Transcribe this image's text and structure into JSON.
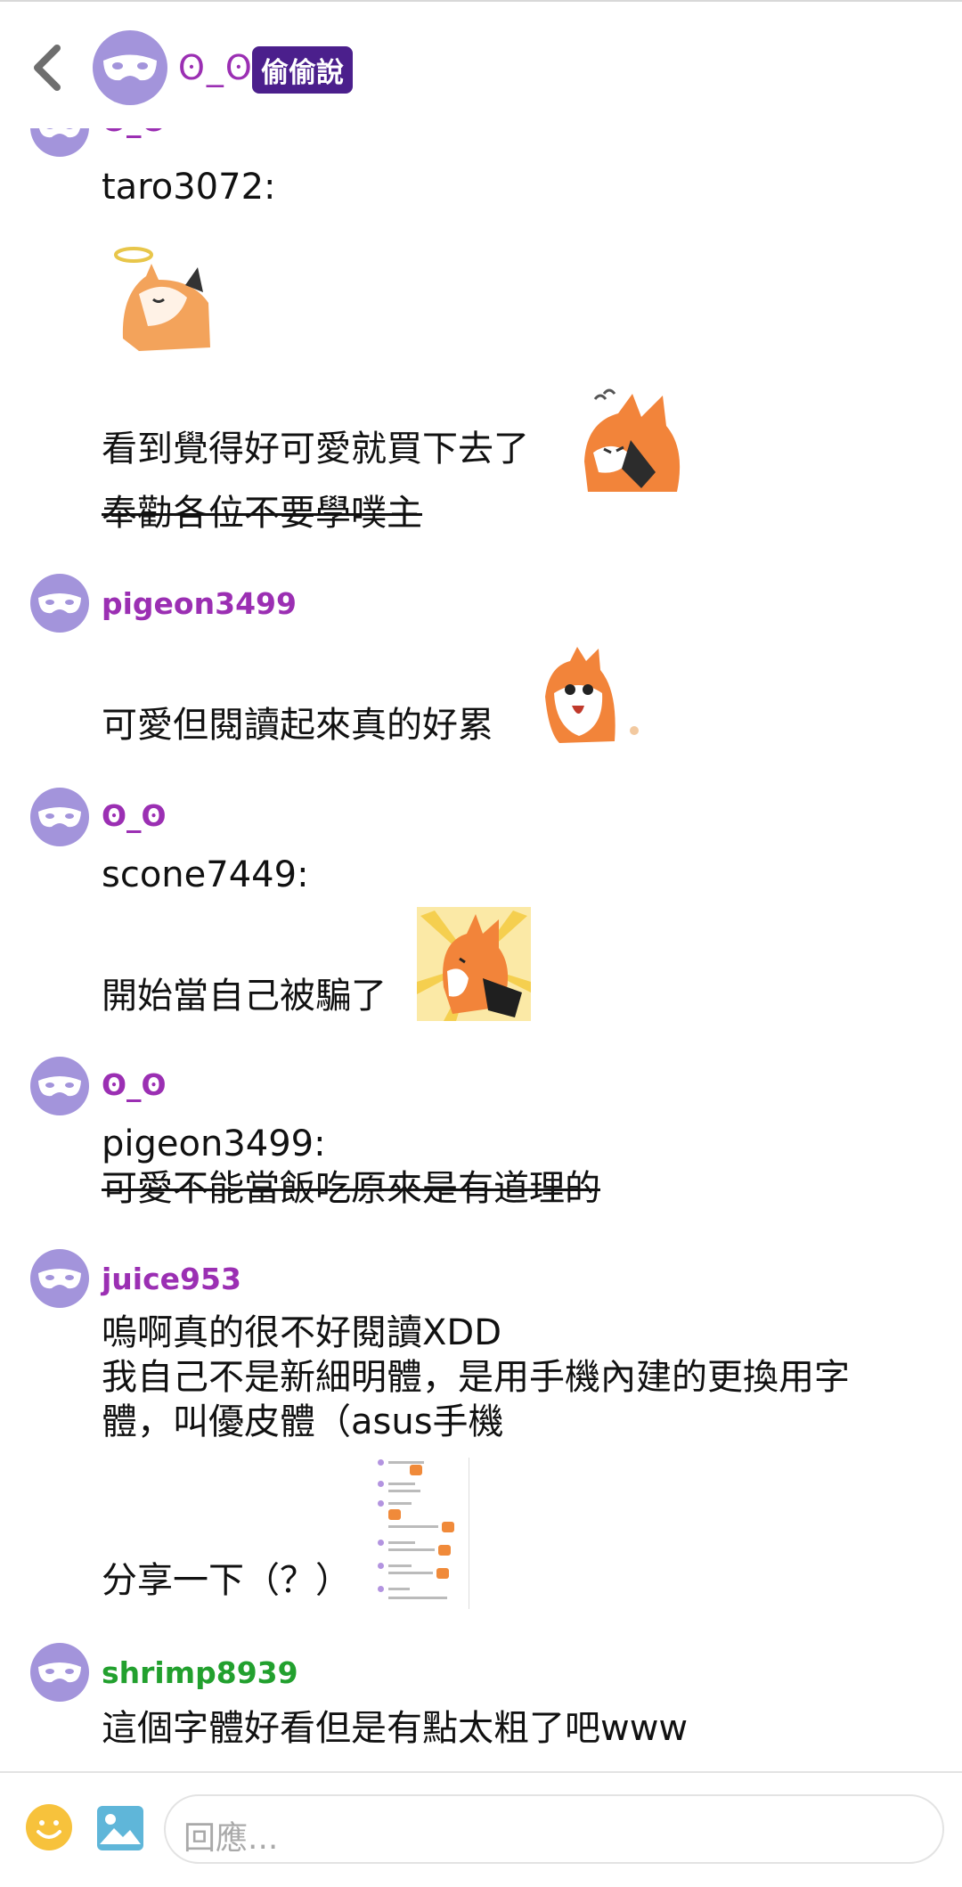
{
  "header": {
    "title": "ʘ_ʘ",
    "badge": "偷偷說"
  },
  "colors": {
    "purple_name": "#9b2fb3",
    "green_name": "#22a02e",
    "avatar": "#a394db",
    "badge_bg": "#4b1f8c"
  },
  "posts": [
    {
      "user": "ʘ_ʘ",
      "lines": [
        "taro3072:"
      ],
      "sticker": "fox-angel-sticker"
    },
    {
      "lines": [
        "看到覺得好可愛就買下去了",
        "奉勸各位不要學噗主"
      ],
      "sticker": "fox-shy-sticker"
    },
    {
      "user": "pigeon3499",
      "lines": [
        "可愛但閱讀起來真的好累"
      ],
      "sticker": "fox-drool-sticker"
    },
    {
      "user": "ʘ_ʘ",
      "lines": [
        "scone7449:",
        "開始當自己被騙了"
      ],
      "sticker": "fox-shocked-sticker"
    },
    {
      "user": "ʘ_ʘ",
      "lines": [
        "pigeon3499:",
        "可愛不能當飯吃原來是有道理的"
      ]
    },
    {
      "user": "juice953",
      "lines": [
        "嗚啊真的很不好閱讀XDD",
        "我自己不是新細明體，是用手機內建的更換用字",
        "體，叫優皮體（asus手機",
        "分享一下（？）"
      ]
    },
    {
      "user": "shrimp8939",
      "lines": [
        "這個字體好看但是有點太粗了吧www"
      ]
    }
  ],
  "composer": {
    "placeholder": "回應..."
  }
}
